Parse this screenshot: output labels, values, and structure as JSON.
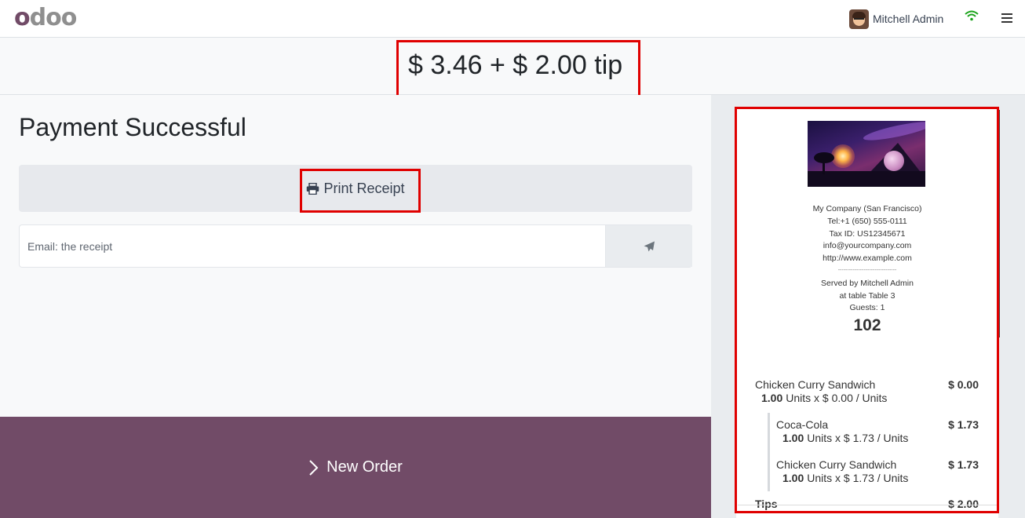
{
  "navbar": {
    "user_name": "Mitchell Admin"
  },
  "header": {
    "amount": "$ 3.46 + $ 2.00 tip"
  },
  "main": {
    "title": "Payment Successful",
    "print_label": "Print Receipt",
    "email_placeholder": "Email: the receipt",
    "new_order_label": "New Order"
  },
  "receipt": {
    "company_name": "My Company (San Francisco)",
    "phone": "Tel:+1 (650) 555-0111",
    "tax_id": "Tax ID: US12345671",
    "email": "info@yourcompany.com",
    "website": "http://www.example.com",
    "separator": "--------------------------------",
    "served_by": "Served by Mitchell Admin",
    "table": "at table Table 3",
    "guests": "Guests: 1",
    "order_number": "102",
    "lines": [
      {
        "name": "Chicken Curry Sandwich",
        "price": "$ 0.00",
        "qty": "1.00",
        "unit_text": "Units x $ 0.00 / Units"
      },
      {
        "name": "Coca-Cola",
        "price": "$ 1.73",
        "qty": "1.00",
        "unit_text": "Units x $ 1.73 / Units"
      },
      {
        "name": "Chicken Curry Sandwich",
        "price": "$ 1.73",
        "qty": "1.00",
        "unit_text": "Units x $ 1.73 / Units"
      }
    ],
    "tips_label": "Tips",
    "tips_price": "$ 2.00"
  },
  "colors": {
    "brand": "#714B67",
    "highlight": "#e00000",
    "wifi": "#1aa31a"
  }
}
